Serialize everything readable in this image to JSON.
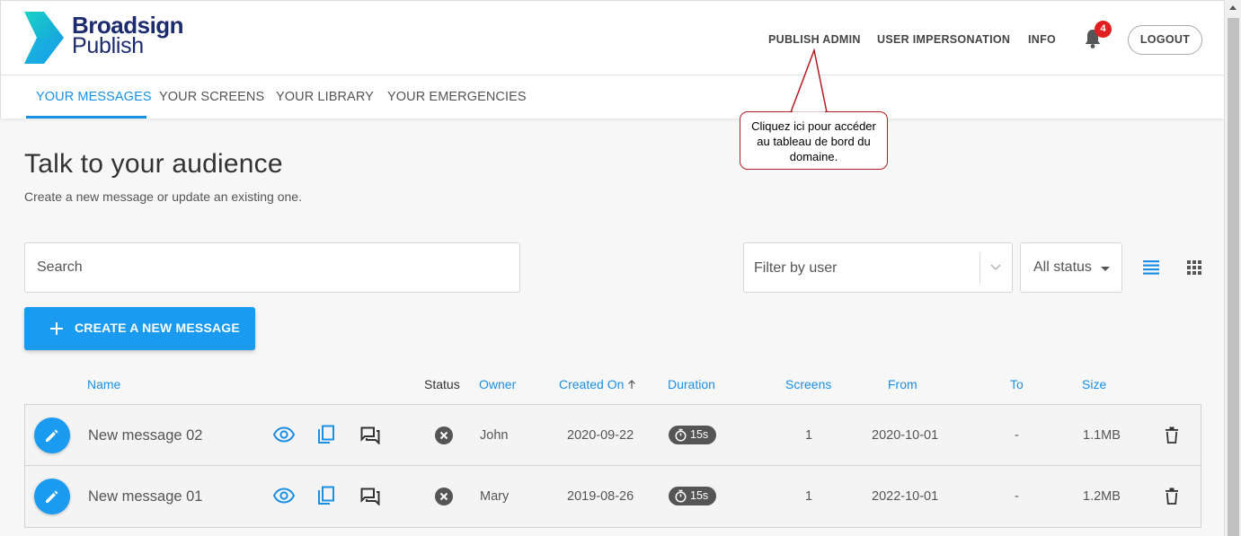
{
  "app": {
    "logo_line1": "Broadsign",
    "logo_line2": "Publish"
  },
  "topnav": {
    "publish_admin": "PUBLISH ADMIN",
    "user_impersonation": "USER IMPERSONATION",
    "info": "INFO",
    "notification_count": "4",
    "logout": "LOGOUT"
  },
  "tabs": [
    {
      "label": "YOUR MESSAGES",
      "active": true
    },
    {
      "label": "YOUR SCREENS",
      "active": false
    },
    {
      "label": "YOUR LIBRARY",
      "active": false
    },
    {
      "label": "YOUR EMERGENCIES",
      "active": false
    }
  ],
  "page": {
    "title": "Talk to your audience",
    "subtitle": "Create a new message or update an existing one."
  },
  "controls": {
    "search_placeholder": "Search",
    "filter_placeholder": "Filter by user",
    "status_value": "All status",
    "create_label": "CREATE A NEW MESSAGE"
  },
  "table": {
    "headers": {
      "name": "Name",
      "status": "Status",
      "owner": "Owner",
      "created_on": "Created On",
      "duration": "Duration",
      "screens": "Screens",
      "from": "From",
      "to": "To",
      "size": "Size"
    },
    "rows": [
      {
        "name": "New message 02",
        "owner": "John",
        "created_on": "2020-09-22",
        "duration": "15s",
        "screens": "1",
        "from": "2020-10-01",
        "to": "-",
        "size": "1.1MB"
      },
      {
        "name": "New message 01",
        "owner": "Mary",
        "created_on": "2019-08-26",
        "duration": "15s",
        "screens": "1",
        "from": "2022-10-01",
        "to": "-",
        "size": "1.2MB"
      }
    ]
  },
  "callout": {
    "line1": "Cliquez ici pour accéder",
    "line2": "au tableau de bord du",
    "line3": "domaine."
  },
  "colors": {
    "accent": "#1a8fe3",
    "button": "#1a9bf0",
    "badge": "#e02020",
    "callout_border": "#b01c24",
    "logo_navy": "#1c2a6e",
    "logo_teal": "#17c8c0"
  }
}
